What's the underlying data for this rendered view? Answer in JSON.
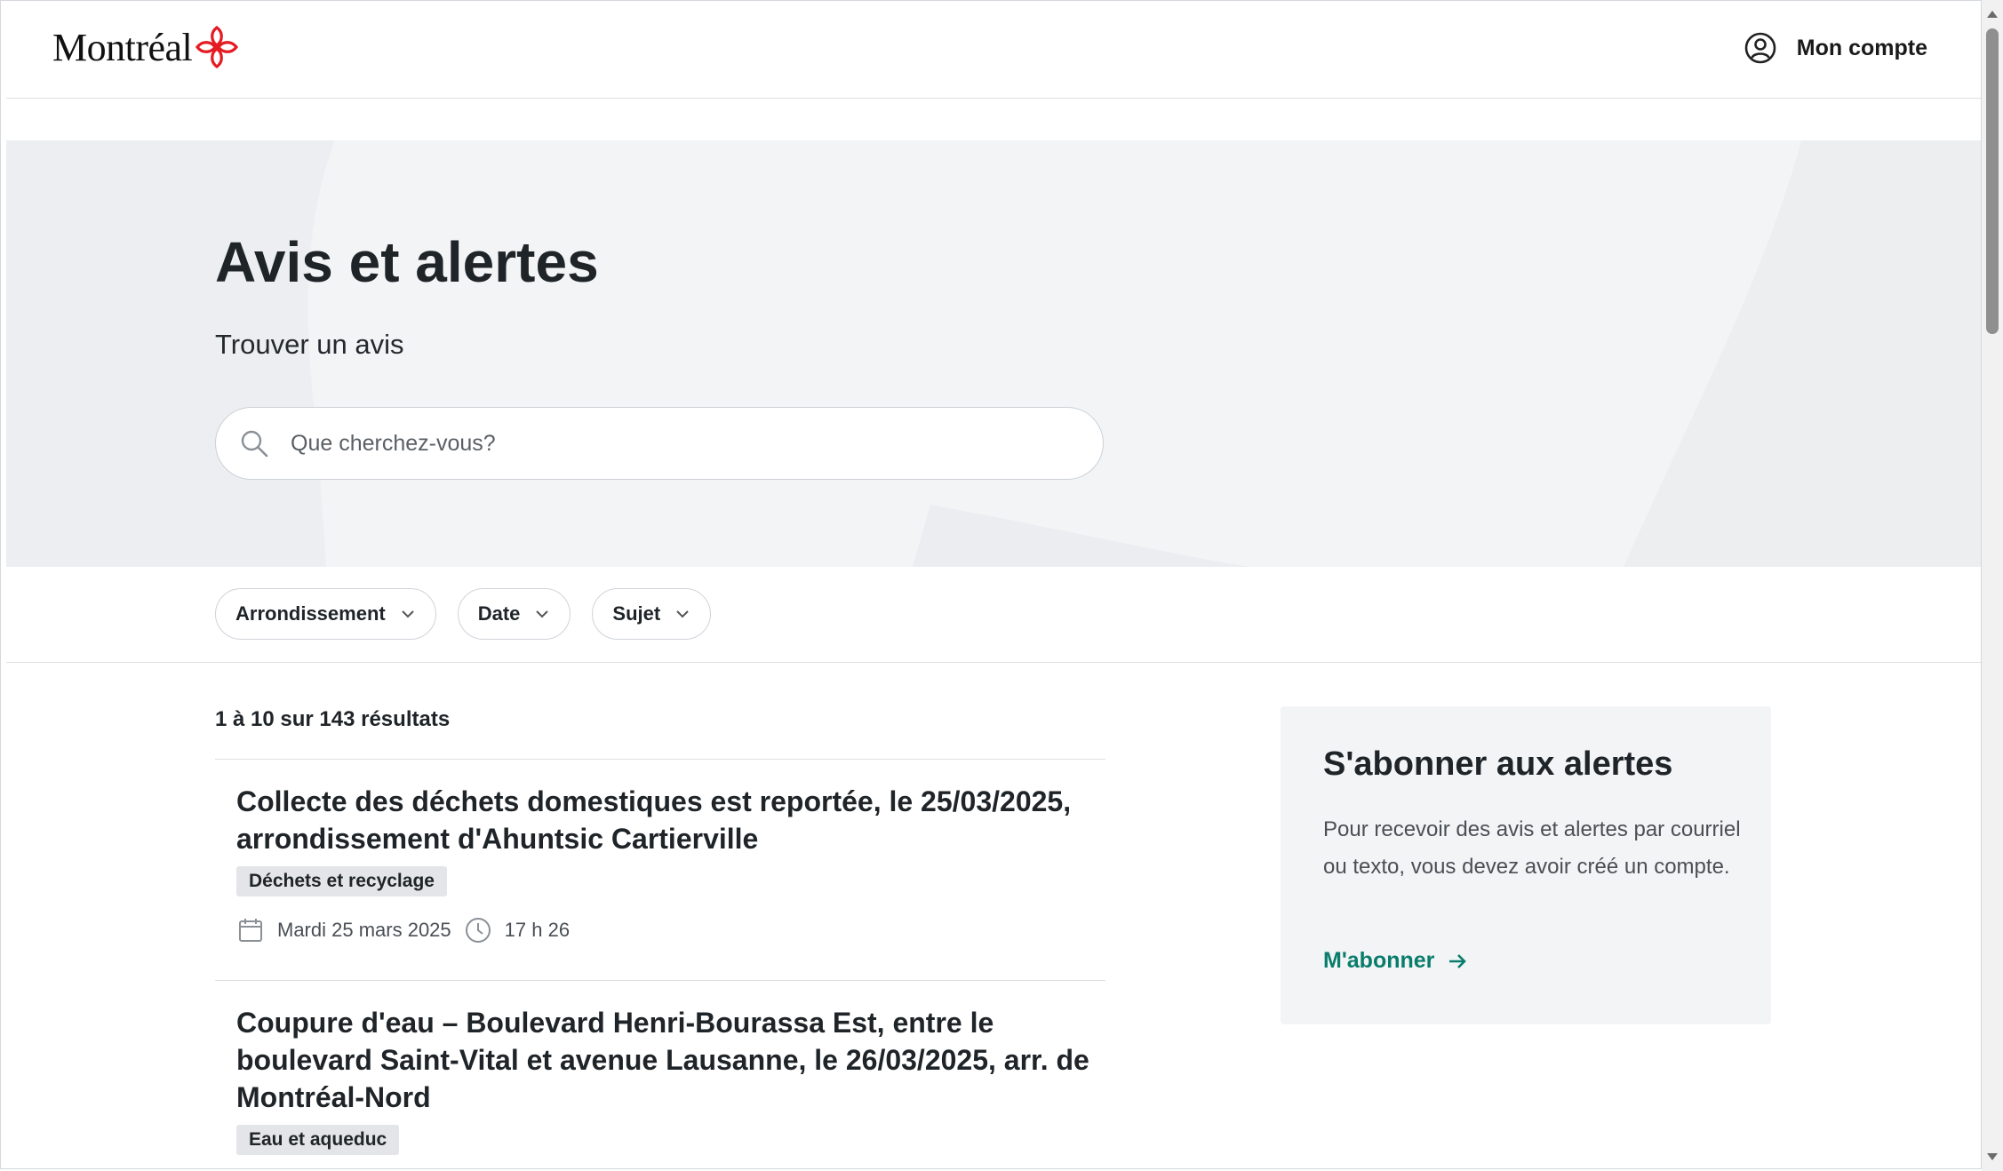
{
  "header": {
    "logo_text": "Montréal",
    "account_label": "Mon compte"
  },
  "hero": {
    "title": "Avis et alertes",
    "subtitle": "Trouver un avis",
    "search_placeholder": "Que cherchez-vous?"
  },
  "filters": [
    {
      "label": "Arrondissement"
    },
    {
      "label": "Date"
    },
    {
      "label": "Sujet"
    }
  ],
  "results": {
    "count_text": "1 à 10 sur 143 résultats",
    "items": [
      {
        "title": "Collecte des déchets domestiques est reportée, le 25/03/2025, arrondissement d'Ahuntsic Cartierville",
        "tag": "Déchets et recyclage",
        "date": "Mardi 25 mars 2025",
        "time": "17 h 26"
      },
      {
        "title": "Coupure d'eau – Boulevard Henri-Bourassa Est, entre le boulevard Saint-Vital et avenue Lausanne, le 26/03/2025, arr. de Montréal-Nord",
        "tag": "Eau et aqueduc"
      }
    ]
  },
  "sidebar": {
    "title": "S'abonner aux alertes",
    "text": "Pour recevoir des avis et alertes par courriel ou texto, vous devez avoir créé un compte.",
    "link_label": "M'abonner"
  },
  "colors": {
    "brand_red": "#e41b23",
    "link_green": "#097d6c",
    "hero_bg": "#f3f4f6"
  },
  "icons": [
    "montreal-rosette-icon",
    "account-circle-icon",
    "search-icon",
    "chevron-down-icon",
    "calendar-icon",
    "clock-icon",
    "arrow-right-icon"
  ]
}
